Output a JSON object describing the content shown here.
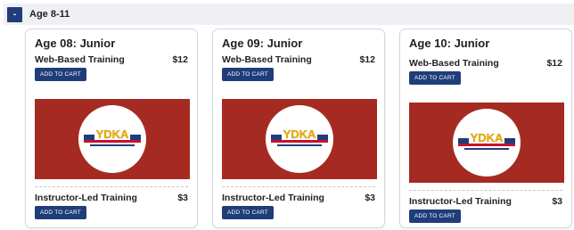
{
  "section": {
    "toggle_symbol": "-",
    "title": "Age 8-11"
  },
  "cards": [
    {
      "title": "Age 08: Junior",
      "web": {
        "label": "Web-Based Training",
        "price": "$12",
        "button": "ADD TO CART"
      },
      "instructor": {
        "label": "Instructor-Led Training",
        "price": "$3",
        "button": "ADD TO CART"
      },
      "logo_text": "YDKA"
    },
    {
      "title": "Age 09: Junior",
      "web": {
        "label": "Web-Based Training",
        "price": "$12",
        "button": "ADD TO CART"
      },
      "instructor": {
        "label": "Instructor-Led Training",
        "price": "$3",
        "button": "ADD TO CART"
      },
      "logo_text": "YDKA"
    },
    {
      "title": "Age 10: Junior",
      "web": {
        "label": "Web-Based Training",
        "price": "$12",
        "button": "ADD TO CART"
      },
      "instructor": {
        "label": "Instructor-Led Training",
        "price": "$3",
        "button": "ADD TO CART"
      },
      "logo_text": "YDKA"
    }
  ],
  "colors": {
    "accent": "#1f3d7a",
    "banner": "#a52b22",
    "logo_yellow": "#f2b705",
    "logo_red": "#c8102e",
    "logo_blue": "#1f3d7a"
  }
}
